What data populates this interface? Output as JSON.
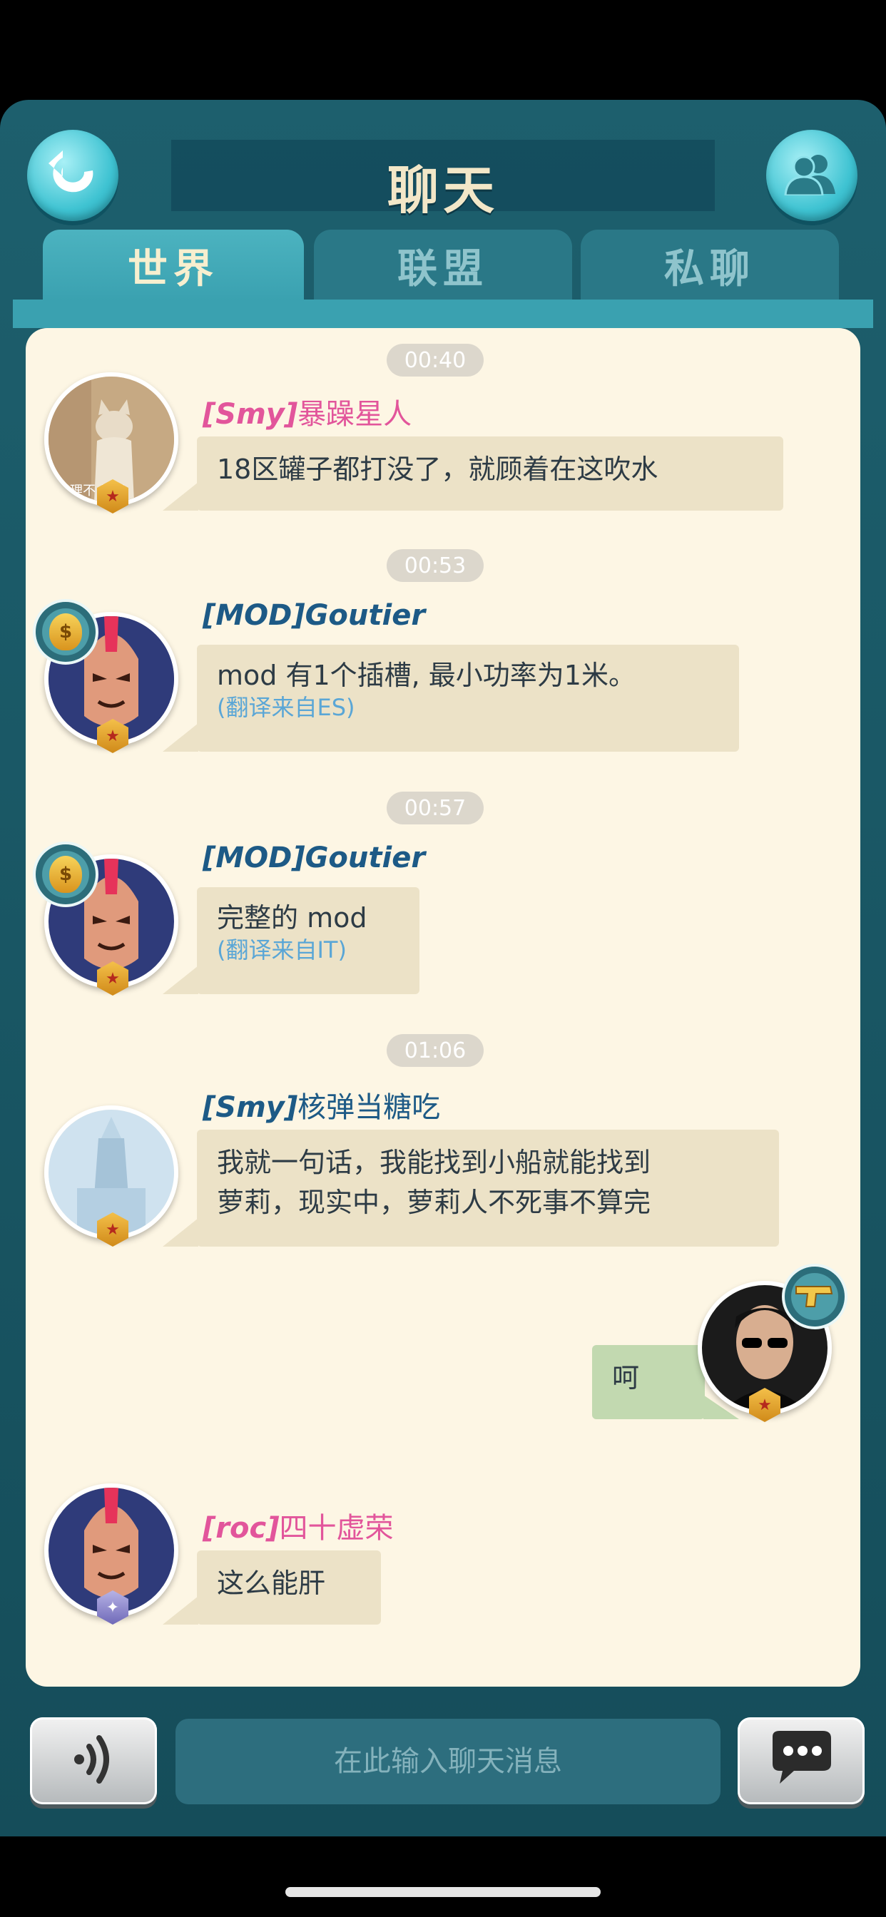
{
  "header": {
    "title": "聊天",
    "back_icon": "back-arrow-icon",
    "friends_icon": "friends-icon"
  },
  "tabs": [
    {
      "label": "世界",
      "active": true
    },
    {
      "label": "联盟",
      "active": false
    },
    {
      "label": "私聊",
      "active": false
    }
  ],
  "messages": [
    {
      "time": "00:40",
      "guild": "[Smy]",
      "nick": "暴躁星人",
      "text": "18区罐子都打没了，就顾着在这吹水"
    },
    {
      "time": "00:53",
      "guild": "[MOD]",
      "nick": "Goutier",
      "text": "mod 有1个插槽, 最小功率为1米。",
      "translated": "(翻译来自ES)"
    },
    {
      "time": "00:57",
      "guild": "[MOD]",
      "nick": "Goutier",
      "text": "完整的 mod",
      "translated": "(翻译来自IT)"
    },
    {
      "time": "01:06",
      "guild": "[Smy]",
      "nick": "核弹当糖吃",
      "text_line1": "我就一句话，我能找到小船就能找到",
      "text_line2": "萝莉，现实中，萝莉人不死事不算完"
    },
    {
      "mine": true,
      "text": "呵"
    },
    {
      "guild": "[roc]",
      "nick": "四十虚荣",
      "text": "这么能肝"
    }
  ],
  "avatar_caption": "理不      世纪",
  "input": {
    "placeholder": "在此输入聊天消息"
  },
  "colors": {
    "panel": "#1d5f6d",
    "chat_bg": "#fdf6e4",
    "bubble": "#ece2c7",
    "mine_bubble": "#c2d9b0",
    "pink_name": "#e2559b",
    "blue_name": "#1d5a86"
  }
}
